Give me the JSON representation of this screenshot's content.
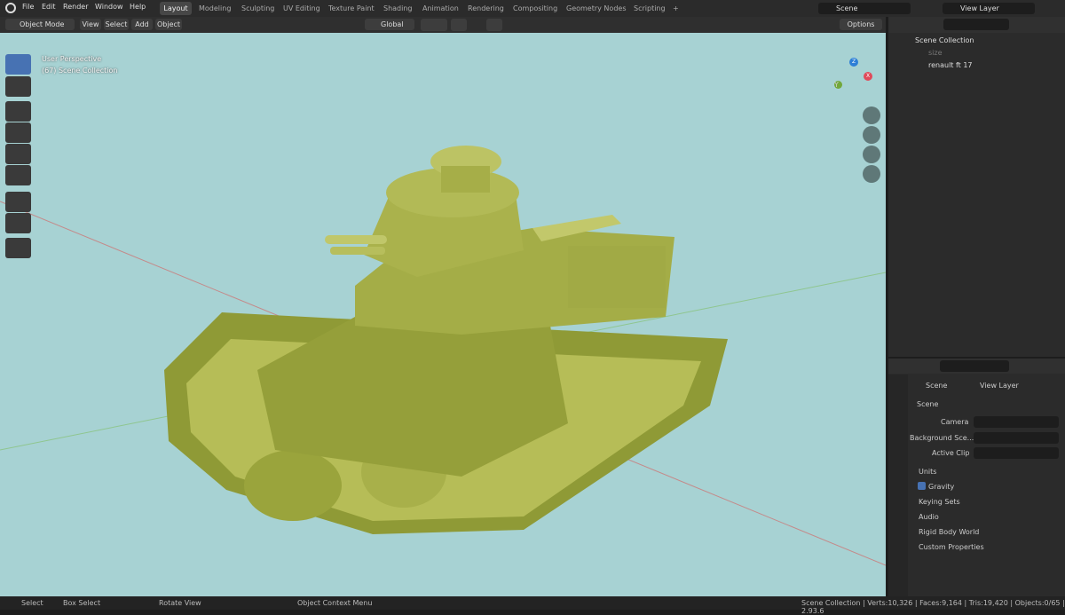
{
  "menu": {
    "file": "File",
    "edit": "Edit",
    "render": "Render",
    "window": "Window",
    "help": "Help"
  },
  "workspaces": [
    "Layout",
    "Modeling",
    "Sculpting",
    "UV Editing",
    "Texture Paint",
    "Shading",
    "Animation",
    "Rendering",
    "Compositing",
    "Geometry Nodes",
    "Scripting",
    "+"
  ],
  "scene_field": "Scene",
  "view_layer_field": "View Layer",
  "vp_header": {
    "mode": "Object Mode",
    "view": "View",
    "select": "Select",
    "add": "Add",
    "object": "Object",
    "orientation": "Global",
    "options": "Options"
  },
  "overlay": {
    "perspective": "User Perspective",
    "collection": "(67) Scene Collection"
  },
  "gizmo": {
    "x": "X",
    "y": "Y",
    "z": "Z"
  },
  "outliner": {
    "root": "Scene Collection",
    "item1": "size",
    "item2": "renault ft 17"
  },
  "properties": {
    "tab_scene": "Scene",
    "tab_view_layer": "View Layer",
    "section": "Scene",
    "camera": "Camera",
    "background": "Background Sce...",
    "active_clip": "Active Clip",
    "units": "Units",
    "gravity": "Gravity",
    "keying_sets": "Keying Sets",
    "audio": "Audio",
    "rigid_body_world": "Rigid Body World",
    "custom_properties": "Custom Properties"
  },
  "status": {
    "select": "Select",
    "box_select": "Box Select",
    "rotate_view": "Rotate View",
    "context_menu": "Object Context Menu",
    "stats": "Scene Collection | Verts:10,326 | Faces:9,164 | Tris:19,420 | Objects:0/65 | 2.93.6"
  },
  "colors": {
    "accent": "#4772b3",
    "viewport_bg": "#a7d2d3",
    "tank": "#8f9a36"
  }
}
